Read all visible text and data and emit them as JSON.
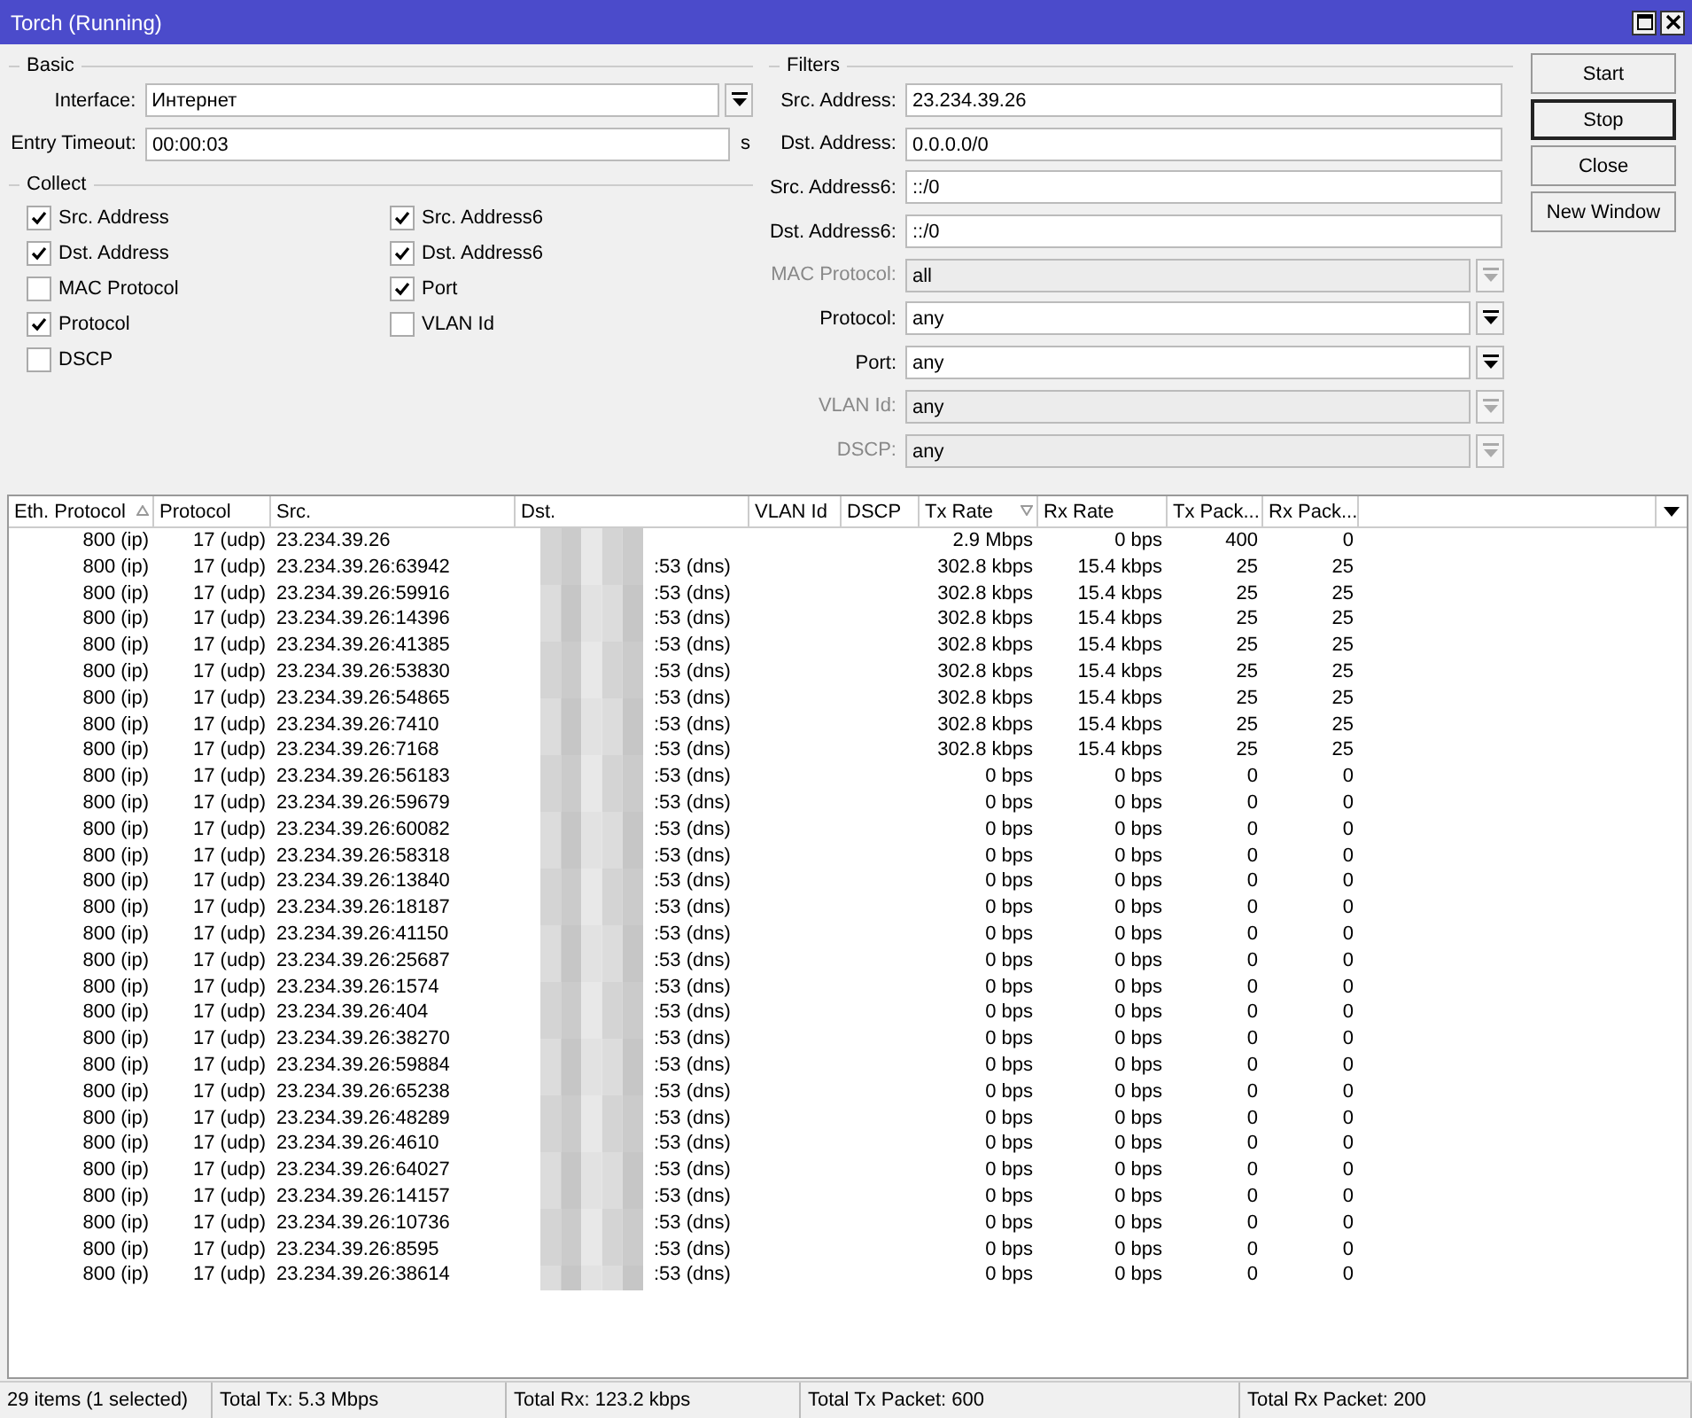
{
  "window": {
    "title": "Torch (Running)"
  },
  "basic": {
    "legend": "Basic",
    "interface": {
      "label": "Interface:",
      "value": "Интернет"
    },
    "entry_timeout": {
      "label": "Entry Timeout:",
      "value": "00:00:03",
      "unit": "s"
    }
  },
  "collect": {
    "legend": "Collect",
    "columns": [
      [
        {
          "label": "Src. Address",
          "checked": true
        },
        {
          "label": "Dst. Address",
          "checked": true
        },
        {
          "label": "MAC Protocol",
          "checked": false
        },
        {
          "label": "Protocol",
          "checked": true
        },
        {
          "label": "DSCP",
          "checked": false
        }
      ],
      [
        {
          "label": "Src. Address6",
          "checked": true
        },
        {
          "label": "Dst. Address6",
          "checked": true
        },
        {
          "label": "Port",
          "checked": true
        },
        {
          "label": "VLAN Id",
          "checked": false
        }
      ]
    ]
  },
  "filters": {
    "legend": "Filters",
    "fields": [
      {
        "label": "Src. Address:",
        "value": "23.234.39.26",
        "kind": "text",
        "disabled": false
      },
      {
        "label": "Dst. Address:",
        "value": "0.0.0.0/0",
        "kind": "text",
        "disabled": false
      },
      {
        "label": "Src. Address6:",
        "value": "::/0",
        "kind": "text",
        "disabled": false
      },
      {
        "label": "Dst. Address6:",
        "value": "::/0",
        "kind": "text",
        "disabled": false
      },
      {
        "label": "MAC Protocol:",
        "value": "all",
        "kind": "select",
        "disabled": true
      },
      {
        "label": "Protocol:",
        "value": "any",
        "kind": "select",
        "disabled": false
      },
      {
        "label": "Port:",
        "value": "any",
        "kind": "select",
        "disabled": false
      },
      {
        "label": "VLAN Id:",
        "value": "any",
        "kind": "select",
        "disabled": true
      },
      {
        "label": "DSCP:",
        "value": "any",
        "kind": "select",
        "disabled": true
      }
    ]
  },
  "buttons": [
    {
      "label": "Start",
      "default": false
    },
    {
      "label": "Stop",
      "default": true
    },
    {
      "label": "Close",
      "default": false
    },
    {
      "label": "New Window",
      "default": false
    }
  ],
  "table": {
    "columns": [
      {
        "label": "Eth. Protocol",
        "sorted": true,
        "descending": false
      },
      {
        "label": "Protocol",
        "sorted": false
      },
      {
        "label": "Src.",
        "sorted": false
      },
      {
        "label": "Dst.",
        "sorted": false
      },
      {
        "label": "VLAN Id",
        "sorted": false
      },
      {
        "label": "DSCP",
        "sorted": false
      },
      {
        "label": "Tx Rate",
        "sorted": true,
        "descending": true
      },
      {
        "label": "Rx Rate",
        "sorted": false
      },
      {
        "label": "Tx Pack...",
        "sorted": false
      },
      {
        "label": "Rx Pack...",
        "sorted": false
      }
    ],
    "rows": [
      {
        "eth": "800 (ip)",
        "protocol": "17 (udp)",
        "src": "23.234.39.26",
        "tx_rate": "2.9 Mbps",
        "rx_rate": "0 bps",
        "tx_packets": "400",
        "rx_packets": "0"
      },
      {
        "eth": "800 (ip)",
        "protocol": "17 (udp)",
        "src": "23.234.39.26:63942",
        "dst": ":53 (dns)",
        "tx_rate": "302.8 kbps",
        "rx_rate": "15.4 kbps",
        "tx_packets": "25",
        "rx_packets": "25"
      },
      {
        "eth": "800 (ip)",
        "protocol": "17 (udp)",
        "src": "23.234.39.26:59916",
        "dst": ":53 (dns)",
        "tx_rate": "302.8 kbps",
        "rx_rate": "15.4 kbps",
        "tx_packets": "25",
        "rx_packets": "25"
      },
      {
        "eth": "800 (ip)",
        "protocol": "17 (udp)",
        "src": "23.234.39.26:14396",
        "dst": ":53 (dns)",
        "tx_rate": "302.8 kbps",
        "rx_rate": "15.4 kbps",
        "tx_packets": "25",
        "rx_packets": "25"
      },
      {
        "eth": "800 (ip)",
        "protocol": "17 (udp)",
        "src": "23.234.39.26:41385",
        "dst": ":53 (dns)",
        "tx_rate": "302.8 kbps",
        "rx_rate": "15.4 kbps",
        "tx_packets": "25",
        "rx_packets": "25"
      },
      {
        "eth": "800 (ip)",
        "protocol": "17 (udp)",
        "src": "23.234.39.26:53830",
        "dst": ":53 (dns)",
        "tx_rate": "302.8 kbps",
        "rx_rate": "15.4 kbps",
        "tx_packets": "25",
        "rx_packets": "25"
      },
      {
        "eth": "800 (ip)",
        "protocol": "17 (udp)",
        "src": "23.234.39.26:54865",
        "dst": ":53 (dns)",
        "tx_rate": "302.8 kbps",
        "rx_rate": "15.4 kbps",
        "tx_packets": "25",
        "rx_packets": "25"
      },
      {
        "eth": "800 (ip)",
        "protocol": "17 (udp)",
        "src": "23.234.39.26:7410",
        "dst": ":53 (dns)",
        "tx_rate": "302.8 kbps",
        "rx_rate": "15.4 kbps",
        "tx_packets": "25",
        "rx_packets": "25"
      },
      {
        "eth": "800 (ip)",
        "protocol": "17 (udp)",
        "src": "23.234.39.26:7168",
        "dst": ":53 (dns)",
        "tx_rate": "302.8 kbps",
        "rx_rate": "15.4 kbps",
        "tx_packets": "25",
        "rx_packets": "25"
      },
      {
        "eth": "800 (ip)",
        "protocol": "17 (udp)",
        "src": "23.234.39.26:56183",
        "dst": ":53 (dns)",
        "tx_rate": "0 bps",
        "rx_rate": "0 bps",
        "tx_packets": "0",
        "rx_packets": "0"
      },
      {
        "eth": "800 (ip)",
        "protocol": "17 (udp)",
        "src": "23.234.39.26:59679",
        "dst": ":53 (dns)",
        "tx_rate": "0 bps",
        "rx_rate": "0 bps",
        "tx_packets": "0",
        "rx_packets": "0"
      },
      {
        "eth": "800 (ip)",
        "protocol": "17 (udp)",
        "src": "23.234.39.26:60082",
        "dst": ":53 (dns)",
        "tx_rate": "0 bps",
        "rx_rate": "0 bps",
        "tx_packets": "0",
        "rx_packets": "0"
      },
      {
        "eth": "800 (ip)",
        "protocol": "17 (udp)",
        "src": "23.234.39.26:58318",
        "dst": ":53 (dns)",
        "tx_rate": "0 bps",
        "rx_rate": "0 bps",
        "tx_packets": "0",
        "rx_packets": "0"
      },
      {
        "eth": "800 (ip)",
        "protocol": "17 (udp)",
        "src": "23.234.39.26:13840",
        "dst": ":53 (dns)",
        "tx_rate": "0 bps",
        "rx_rate": "0 bps",
        "tx_packets": "0",
        "rx_packets": "0"
      },
      {
        "eth": "800 (ip)",
        "protocol": "17 (udp)",
        "src": "23.234.39.26:18187",
        "dst": ":53 (dns)",
        "tx_rate": "0 bps",
        "rx_rate": "0 bps",
        "tx_packets": "0",
        "rx_packets": "0"
      },
      {
        "eth": "800 (ip)",
        "protocol": "17 (udp)",
        "src": "23.234.39.26:41150",
        "dst": ":53 (dns)",
        "tx_rate": "0 bps",
        "rx_rate": "0 bps",
        "tx_packets": "0",
        "rx_packets": "0"
      },
      {
        "eth": "800 (ip)",
        "protocol": "17 (udp)",
        "src": "23.234.39.26:25687",
        "dst": ":53 (dns)",
        "tx_rate": "0 bps",
        "rx_rate": "0 bps",
        "tx_packets": "0",
        "rx_packets": "0"
      },
      {
        "eth": "800 (ip)",
        "protocol": "17 (udp)",
        "src": "23.234.39.26:1574",
        "dst": ":53 (dns)",
        "tx_rate": "0 bps",
        "rx_rate": "0 bps",
        "tx_packets": "0",
        "rx_packets": "0"
      },
      {
        "eth": "800 (ip)",
        "protocol": "17 (udp)",
        "src": "23.234.39.26:404",
        "dst": ":53 (dns)",
        "tx_rate": "0 bps",
        "rx_rate": "0 bps",
        "tx_packets": "0",
        "rx_packets": "0"
      },
      {
        "eth": "800 (ip)",
        "protocol": "17 (udp)",
        "src": "23.234.39.26:38270",
        "dst": ":53 (dns)",
        "tx_rate": "0 bps",
        "rx_rate": "0 bps",
        "tx_packets": "0",
        "rx_packets": "0"
      },
      {
        "eth": "800 (ip)",
        "protocol": "17 (udp)",
        "src": "23.234.39.26:59884",
        "dst": ":53 (dns)",
        "tx_rate": "0 bps",
        "rx_rate": "0 bps",
        "tx_packets": "0",
        "rx_packets": "0"
      },
      {
        "eth": "800 (ip)",
        "protocol": "17 (udp)",
        "src": "23.234.39.26:65238",
        "dst": ":53 (dns)",
        "tx_rate": "0 bps",
        "rx_rate": "0 bps",
        "tx_packets": "0",
        "rx_packets": "0"
      },
      {
        "eth": "800 (ip)",
        "protocol": "17 (udp)",
        "src": "23.234.39.26:48289",
        "dst": ":53 (dns)",
        "tx_rate": "0 bps",
        "rx_rate": "0 bps",
        "tx_packets": "0",
        "rx_packets": "0"
      },
      {
        "eth": "800 (ip)",
        "protocol": "17 (udp)",
        "src": "23.234.39.26:4610",
        "dst": ":53 (dns)",
        "tx_rate": "0 bps",
        "rx_rate": "0 bps",
        "tx_packets": "0",
        "rx_packets": "0"
      },
      {
        "eth": "800 (ip)",
        "protocol": "17 (udp)",
        "src": "23.234.39.26:64027",
        "dst": ":53 (dns)",
        "tx_rate": "0 bps",
        "rx_rate": "0 bps",
        "tx_packets": "0",
        "rx_packets": "0"
      },
      {
        "eth": "800 (ip)",
        "protocol": "17 (udp)",
        "src": "23.234.39.26:14157",
        "dst": ":53 (dns)",
        "tx_rate": "0 bps",
        "rx_rate": "0 bps",
        "tx_packets": "0",
        "rx_packets": "0"
      },
      {
        "eth": "800 (ip)",
        "protocol": "17 (udp)",
        "src": "23.234.39.26:10736",
        "dst": ":53 (dns)",
        "tx_rate": "0 bps",
        "rx_rate": "0 bps",
        "tx_packets": "0",
        "rx_packets": "0"
      },
      {
        "eth": "800 (ip)",
        "protocol": "17 (udp)",
        "src": "23.234.39.26:8595",
        "dst": ":53 (dns)",
        "tx_rate": "0 bps",
        "rx_rate": "0 bps",
        "tx_packets": "0",
        "rx_packets": "0"
      },
      {
        "eth": "800 (ip)",
        "protocol": "17 (udp)",
        "src": "23.234.39.26:38614",
        "dst": ":53 (dns)",
        "tx_rate": "0 bps",
        "rx_rate": "0 bps",
        "tx_packets": "0",
        "rx_packets": "0"
      }
    ]
  },
  "status_bar": [
    "29 items (1 selected)",
    "Total Tx: 5.3 Mbps",
    "Total Rx: 123.2 kbps",
    "Total Tx Packet: 600",
    "Total Rx Packet: 200"
  ]
}
